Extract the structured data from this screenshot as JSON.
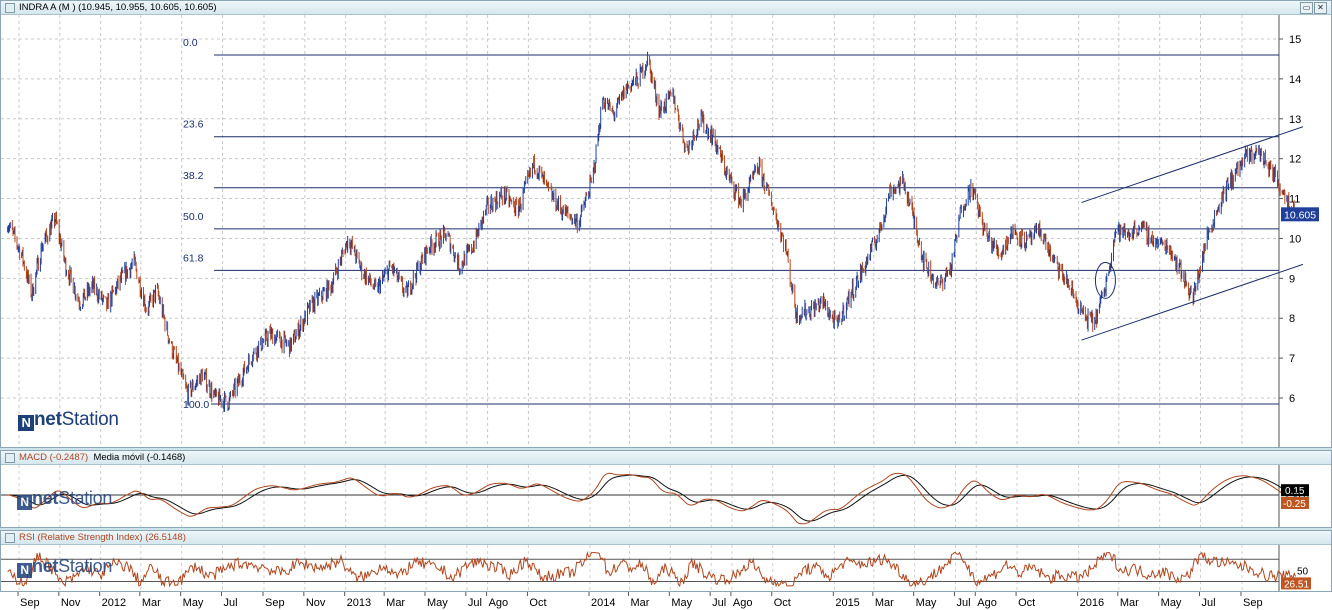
{
  "main_title": "INDRA A (M ) (10.945, 10.955, 10.605, 10.605)",
  "macd_title": "MACD (-0.2487)",
  "macd_signal_title": "Media móvil (-0.1468)",
  "rsi_title": "RSI (Relative Strength Index) (26.5148)",
  "watermark_a": "net",
  "watermark_b": "Station",
  "window_buttons": {
    "restore": "▭",
    "close": "✕"
  },
  "last_price_label": "10.605",
  "macd_labels": {
    "macd": "0.15",
    "zero": "0.0",
    "signal": "-0.25"
  },
  "rsi_labels": {
    "level": "50",
    "last": "26.51"
  },
  "colors": {
    "price_up": "#1f3f9a",
    "price_down": "#b0461f",
    "fib": "#1b2f6b",
    "channel": "#1b2f6b",
    "macd": "#b0461f",
    "signal": "#111111",
    "rsi": "#b0461f",
    "last_price_bg": "#1f3f9a",
    "macd_bg": "#000000",
    "signal_bg": "#c0561f",
    "rsi_bg": "#c0561f"
  },
  "chart_data": [
    {
      "type": "line",
      "panel": "price",
      "ylim": [
        5,
        15.5
      ],
      "yticks": [
        6,
        7,
        8,
        9,
        10,
        11,
        12,
        13,
        14,
        15
      ],
      "x_labels": [
        "Sep",
        "Nov",
        "2012",
        "Mar",
        "May",
        "Jul",
        "Sep",
        "Nov",
        "2013",
        "Mar",
        "May",
        "Jul",
        "Ago",
        "Oct",
        "2014",
        "Mar",
        "May",
        "Jul",
        "Ago",
        "Oct",
        "2015",
        "Mar",
        "May",
        "Jul",
        "Ago",
        "Oct",
        "2016",
        "Mar",
        "May",
        "Jul",
        "Sep"
      ],
      "x_dates": [
        "2011-09",
        "2011-11",
        "2012-01",
        "2012-03",
        "2012-05",
        "2012-07",
        "2012-09",
        "2012-11",
        "2013-01",
        "2013-03",
        "2013-05",
        "2013-07",
        "2013-08",
        "2013-10",
        "2014-01",
        "2014-03",
        "2014-05",
        "2014-07",
        "2014-08",
        "2014-10",
        "2015-01",
        "2015-03",
        "2015-05",
        "2015-07",
        "2015-08",
        "2015-10",
        "2016-01",
        "2016-03",
        "2016-05",
        "2016-07",
        "2016-09"
      ],
      "fibonacci": [
        {
          "label": "0.0",
          "price": 14.6
        },
        {
          "label": "23.6",
          "price": 12.55
        },
        {
          "label": "38.2",
          "price": 11.27
        },
        {
          "label": "50.0",
          "price": 10.24
        },
        {
          "label": "61.8",
          "price": 9.2
        },
        {
          "label": "100.0",
          "price": 5.85
        }
      ],
      "price_anchors": [
        [
          "2011-08-15",
          10.4
        ],
        [
          "2011-09-05",
          9.6
        ],
        [
          "2011-09-20",
          8.6
        ],
        [
          "2011-10-05",
          9.8
        ],
        [
          "2011-10-25",
          10.5
        ],
        [
          "2011-11-10",
          9.3
        ],
        [
          "2011-12-01",
          8.4
        ],
        [
          "2011-12-20",
          8.8
        ],
        [
          "2012-01-10",
          8.3
        ],
        [
          "2012-02-01",
          9.0
        ],
        [
          "2012-02-20",
          9.4
        ],
        [
          "2012-03-10",
          8.2
        ],
        [
          "2012-03-25",
          8.7
        ],
        [
          "2012-04-15",
          7.3
        ],
        [
          "2012-05-10",
          6.1
        ],
        [
          "2012-06-01",
          6.6
        ],
        [
          "2012-06-20",
          6.0
        ],
        [
          "2012-07-10",
          5.9
        ],
        [
          "2012-07-25",
          6.4
        ],
        [
          "2012-08-15",
          7.1
        ],
        [
          "2012-09-10",
          7.6
        ],
        [
          "2012-10-10",
          7.3
        ],
        [
          "2012-11-10",
          8.3
        ],
        [
          "2012-12-10",
          8.8
        ],
        [
          "2013-01-05",
          10.0
        ],
        [
          "2013-01-25",
          9.2
        ],
        [
          "2013-02-15",
          8.7
        ],
        [
          "2013-03-10",
          9.3
        ],
        [
          "2013-04-01",
          8.6
        ],
        [
          "2013-05-05",
          9.8
        ],
        [
          "2013-06-01",
          10.1
        ],
        [
          "2013-06-20",
          9.3
        ],
        [
          "2013-07-10",
          9.8
        ],
        [
          "2013-08-01",
          10.8
        ],
        [
          "2013-08-25",
          11.1
        ],
        [
          "2013-09-15",
          10.7
        ],
        [
          "2013-10-10",
          11.9
        ],
        [
          "2013-10-30",
          11.2
        ],
        [
          "2013-11-20",
          10.7
        ],
        [
          "2013-12-15",
          10.4
        ],
        [
          "2014-01-05",
          11.5
        ],
        [
          "2014-01-20",
          13.5
        ],
        [
          "2014-02-05",
          13.1
        ],
        [
          "2014-02-25",
          13.8
        ],
        [
          "2014-03-15",
          14.0
        ],
        [
          "2014-03-28",
          14.5
        ],
        [
          "2014-04-15",
          13.2
        ],
        [
          "2014-05-05",
          13.6
        ],
        [
          "2014-05-25",
          12.2
        ],
        [
          "2014-06-15",
          13.0
        ],
        [
          "2014-07-05",
          12.5
        ],
        [
          "2014-07-25",
          11.6
        ],
        [
          "2014-08-15",
          10.9
        ],
        [
          "2014-09-10",
          11.8
        ],
        [
          "2014-10-01",
          10.8
        ],
        [
          "2014-10-20",
          9.8
        ],
        [
          "2014-11-05",
          8.1
        ],
        [
          "2014-11-25",
          8.2
        ],
        [
          "2014-12-15",
          8.4
        ],
        [
          "2015-01-05",
          7.8
        ],
        [
          "2015-01-25",
          8.6
        ],
        [
          "2015-02-15",
          9.3
        ],
        [
          "2015-03-10",
          10.2
        ],
        [
          "2015-03-25",
          11.2
        ],
        [
          "2015-04-15",
          11.4
        ],
        [
          "2015-05-01",
          10.4
        ],
        [
          "2015-05-15",
          9.4
        ],
        [
          "2015-06-05",
          8.8
        ],
        [
          "2015-06-25",
          9.3
        ],
        [
          "2015-07-10",
          10.8
        ],
        [
          "2015-07-25",
          11.3
        ],
        [
          "2015-08-15",
          10.1
        ],
        [
          "2015-09-05",
          9.6
        ],
        [
          "2015-09-25",
          10.2
        ],
        [
          "2015-10-15",
          9.9
        ],
        [
          "2015-11-05",
          10.2
        ],
        [
          "2015-11-25",
          9.4
        ],
        [
          "2015-12-15",
          8.9
        ],
        [
          "2016-01-10",
          8.0
        ],
        [
          "2016-01-25",
          7.9
        ],
        [
          "2016-02-10",
          8.8
        ],
        [
          "2016-02-25",
          10.2
        ],
        [
          "2016-03-15",
          10.1
        ],
        [
          "2016-04-01",
          10.3
        ],
        [
          "2016-04-25",
          9.9
        ],
        [
          "2016-05-15",
          9.8
        ],
        [
          "2016-06-01",
          9.2
        ],
        [
          "2016-06-20",
          8.5
        ],
        [
          "2016-07-10",
          10.0
        ],
        [
          "2016-08-01",
          11.0
        ],
        [
          "2016-08-20",
          11.6
        ],
        [
          "2016-09-05",
          12.0
        ],
        [
          "2016-09-25",
          12.2
        ],
        [
          "2016-10-15",
          11.7
        ],
        [
          "2016-11-05",
          11.1
        ],
        [
          "2016-11-20",
          10.6
        ]
      ],
      "last_price": 10.605,
      "channel": {
        "upper": [
          [
            "2016-01-05",
            10.9
          ],
          [
            "2016-12-01",
            12.8
          ]
        ],
        "lower": [
          [
            "2016-01-05",
            7.45
          ],
          [
            "2016-12-01",
            9.35
          ]
        ]
      },
      "ellipse": {
        "date": "2016-02-10",
        "price": 8.95
      }
    },
    {
      "type": "line",
      "panel": "macd",
      "ylim": [
        -0.6,
        0.5
      ],
      "ticks": [
        0.15,
        0.0,
        -0.25
      ],
      "series": [
        {
          "name": "MACD (-0.2487)",
          "last": -0.2487
        },
        {
          "name": "Media móvil (-0.1468)",
          "last": -0.1468
        }
      ]
    },
    {
      "type": "line",
      "panel": "rsi",
      "ylim": [
        20,
        85
      ],
      "ticks": [
        50
      ],
      "overbought": 70,
      "oversold": 30,
      "series": [
        {
          "name": "RSI (Relative Strength Index) (26.5148)",
          "last": 26.5148
        }
      ]
    }
  ]
}
